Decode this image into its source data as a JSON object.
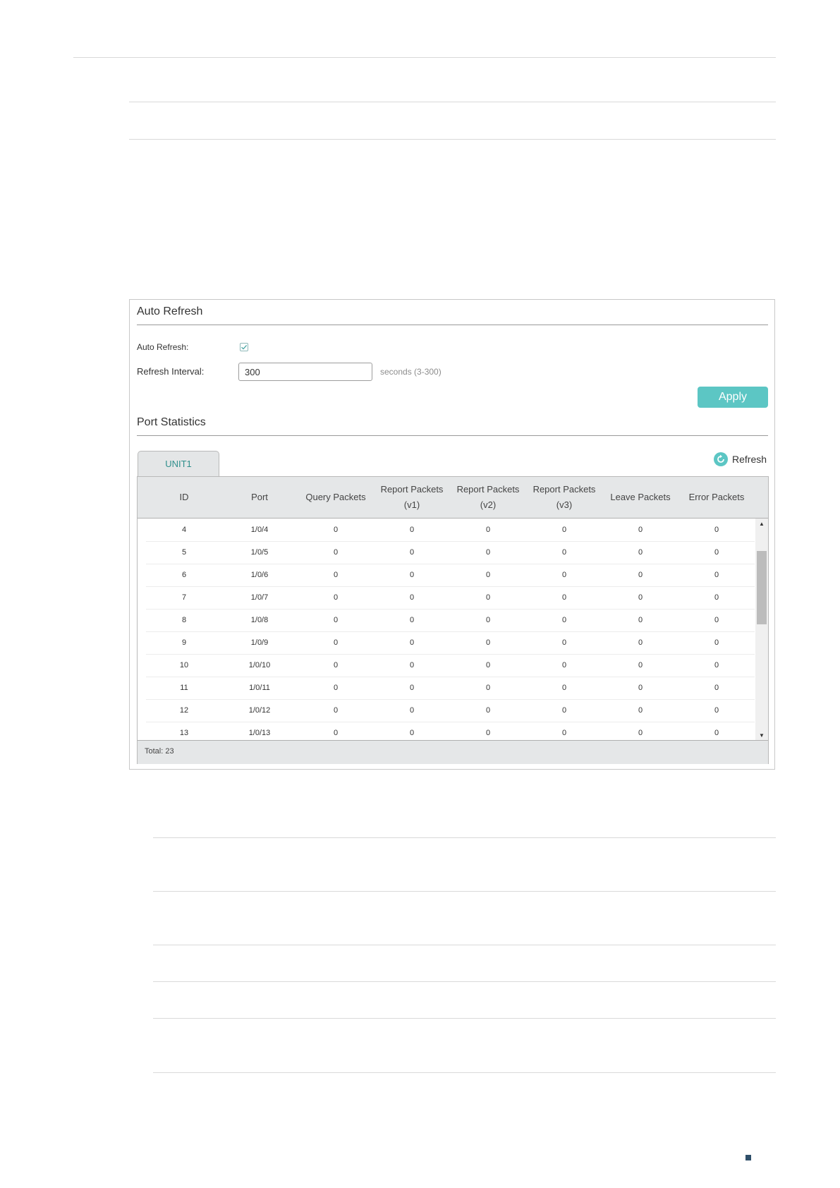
{
  "auto_refresh": {
    "section_title": "Auto Refresh",
    "auto_refresh_label": "Auto Refresh:",
    "auto_refresh_checked": true,
    "interval_label": "Refresh Interval:",
    "interval_value": "300",
    "interval_hint": "seconds (3-300)",
    "apply_label": "Apply"
  },
  "port_statistics": {
    "section_title": "Port Statistics",
    "tab_label": "UNIT1",
    "refresh_label": "Refresh",
    "columns": [
      [
        "ID"
      ],
      [
        "Port"
      ],
      [
        "Query Packets"
      ],
      [
        "Report Packets",
        "(v1)"
      ],
      [
        "Report Packets",
        "(v2)"
      ],
      [
        "Report Packets",
        "(v3)"
      ],
      [
        "Leave Packets"
      ],
      [
        "Error Packets"
      ]
    ],
    "rows": [
      [
        "4",
        "1/0/4",
        "0",
        "0",
        "0",
        "0",
        "0",
        "0"
      ],
      [
        "5",
        "1/0/5",
        "0",
        "0",
        "0",
        "0",
        "0",
        "0"
      ],
      [
        "6",
        "1/0/6",
        "0",
        "0",
        "0",
        "0",
        "0",
        "0"
      ],
      [
        "7",
        "1/0/7",
        "0",
        "0",
        "0",
        "0",
        "0",
        "0"
      ],
      [
        "8",
        "1/0/8",
        "0",
        "0",
        "0",
        "0",
        "0",
        "0"
      ],
      [
        "9",
        "1/0/9",
        "0",
        "0",
        "0",
        "0",
        "0",
        "0"
      ],
      [
        "10",
        "1/0/10",
        "0",
        "0",
        "0",
        "0",
        "0",
        "0"
      ],
      [
        "11",
        "1/0/11",
        "0",
        "0",
        "0",
        "0",
        "0",
        "0"
      ],
      [
        "12",
        "1/0/12",
        "0",
        "0",
        "0",
        "0",
        "0",
        "0"
      ],
      [
        "13",
        "1/0/13",
        "0",
        "0",
        "0",
        "0",
        "0",
        "0"
      ]
    ],
    "total_label": "Total: 23"
  },
  "colors": {
    "accent": "#5cc6c4",
    "tab_text": "#2f8f8c",
    "header_bg": "#e5e7e8"
  }
}
